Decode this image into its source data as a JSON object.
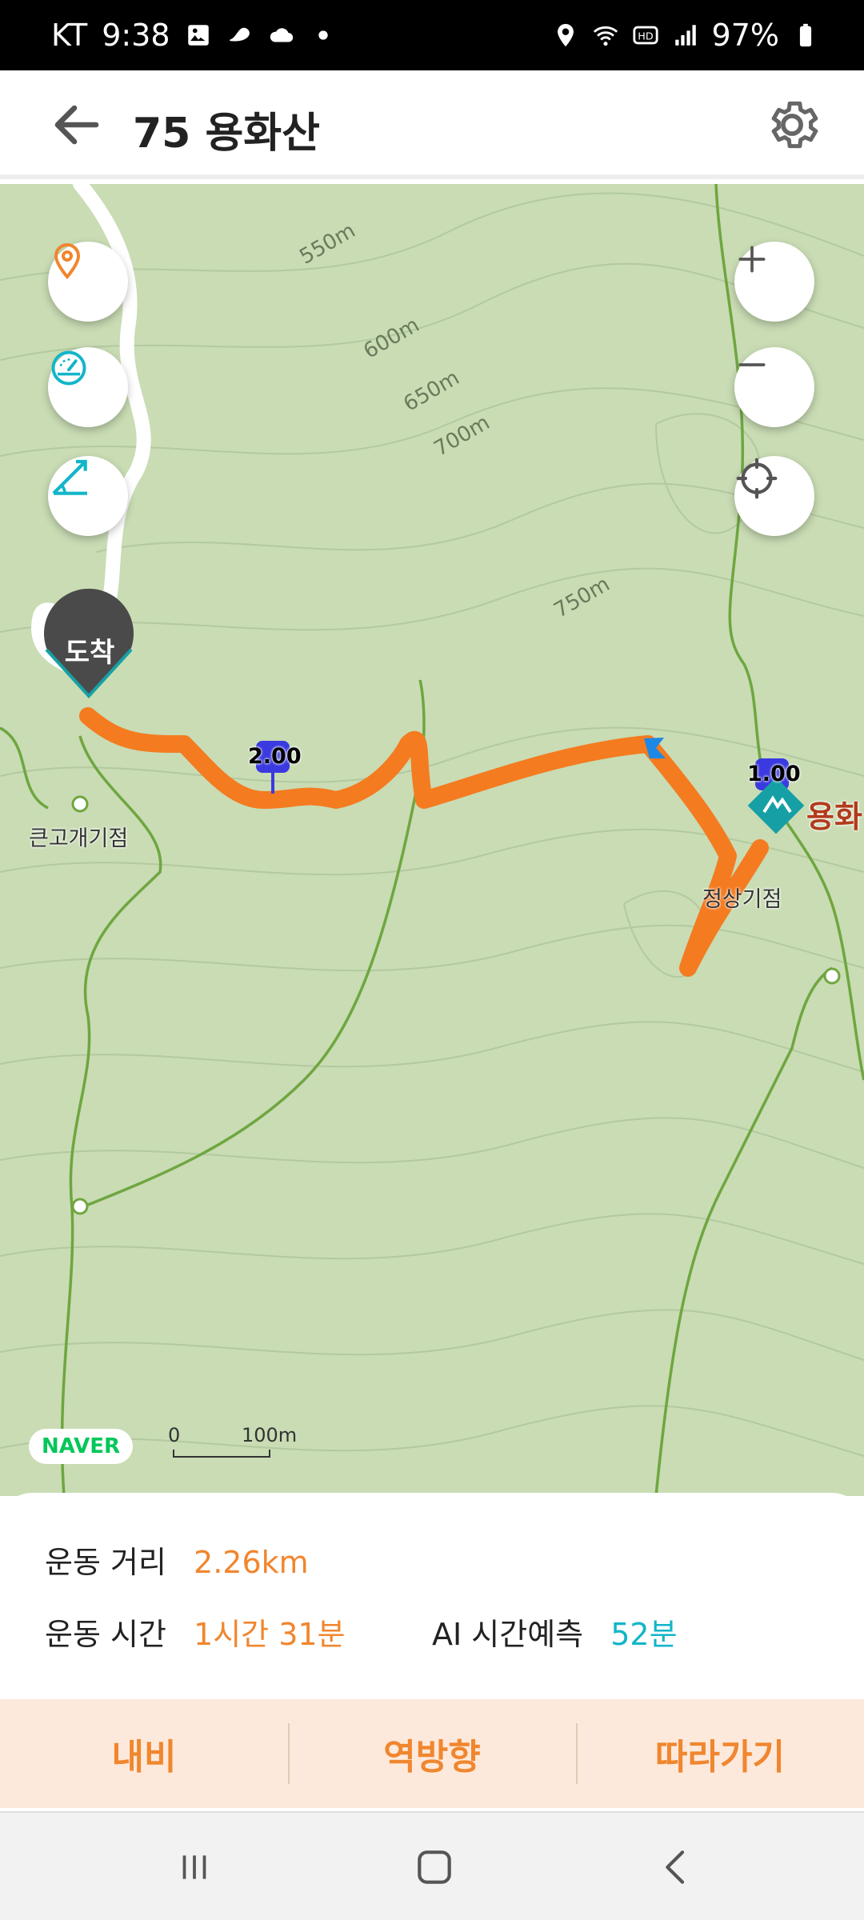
{
  "status_bar": {
    "carrier": "KT",
    "time": "9:38",
    "battery": "97%",
    "icons_left": [
      "gallery-icon",
      "shoe-icon",
      "cloud-icon",
      "dot-icon"
    ],
    "icons_right": [
      "location-icon",
      "wifi-icon",
      "hd-icon",
      "signal-icon",
      "battery-icon"
    ]
  },
  "header": {
    "title": "75 용화산"
  },
  "map": {
    "contour_labels": [
      "550m",
      "600m",
      "650m",
      "700m",
      "750m"
    ],
    "arrival_label": "도착",
    "waypoints": [
      "2.00",
      "1.00"
    ],
    "places": [
      "큰고개기점",
      "용화",
      "정상기점"
    ],
    "naver_logo": "NAVER",
    "scale": {
      "zero": "0",
      "distance": "100m"
    },
    "route_color": "#f47b20"
  },
  "stats": {
    "distance_label": "운동 거리",
    "distance_value": "2.26km",
    "time_label": "운동 시간",
    "time_value": "1시간 31분",
    "ai_label": "AI 시간예측",
    "ai_value": "52분"
  },
  "actions": {
    "navi": "내비",
    "reverse": "역방향",
    "follow": "따라가기"
  },
  "colors": {
    "accent": "#f0862e",
    "teal": "#12b5c9",
    "map_bg": "#c9dcb4"
  }
}
